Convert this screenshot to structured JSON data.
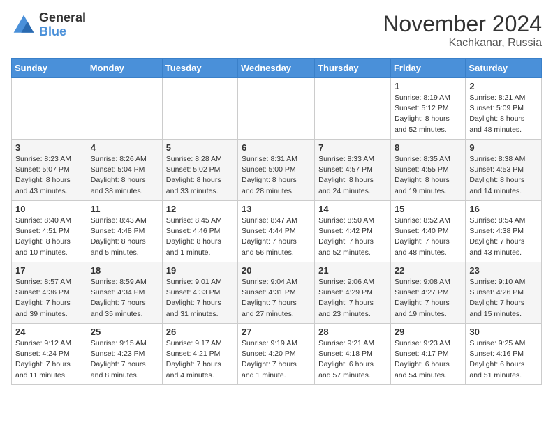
{
  "header": {
    "logo_general": "General",
    "logo_blue": "Blue",
    "month_title": "November 2024",
    "location": "Kachkanar, Russia"
  },
  "days_of_week": [
    "Sunday",
    "Monday",
    "Tuesday",
    "Wednesday",
    "Thursday",
    "Friday",
    "Saturday"
  ],
  "weeks": [
    [
      {
        "day": "",
        "info": ""
      },
      {
        "day": "",
        "info": ""
      },
      {
        "day": "",
        "info": ""
      },
      {
        "day": "",
        "info": ""
      },
      {
        "day": "",
        "info": ""
      },
      {
        "day": "1",
        "info": "Sunrise: 8:19 AM\nSunset: 5:12 PM\nDaylight: 8 hours\nand 52 minutes."
      },
      {
        "day": "2",
        "info": "Sunrise: 8:21 AM\nSunset: 5:09 PM\nDaylight: 8 hours\nand 48 minutes."
      }
    ],
    [
      {
        "day": "3",
        "info": "Sunrise: 8:23 AM\nSunset: 5:07 PM\nDaylight: 8 hours\nand 43 minutes."
      },
      {
        "day": "4",
        "info": "Sunrise: 8:26 AM\nSunset: 5:04 PM\nDaylight: 8 hours\nand 38 minutes."
      },
      {
        "day": "5",
        "info": "Sunrise: 8:28 AM\nSunset: 5:02 PM\nDaylight: 8 hours\nand 33 minutes."
      },
      {
        "day": "6",
        "info": "Sunrise: 8:31 AM\nSunset: 5:00 PM\nDaylight: 8 hours\nand 28 minutes."
      },
      {
        "day": "7",
        "info": "Sunrise: 8:33 AM\nSunset: 4:57 PM\nDaylight: 8 hours\nand 24 minutes."
      },
      {
        "day": "8",
        "info": "Sunrise: 8:35 AM\nSunset: 4:55 PM\nDaylight: 8 hours\nand 19 minutes."
      },
      {
        "day": "9",
        "info": "Sunrise: 8:38 AM\nSunset: 4:53 PM\nDaylight: 8 hours\nand 14 minutes."
      }
    ],
    [
      {
        "day": "10",
        "info": "Sunrise: 8:40 AM\nSunset: 4:51 PM\nDaylight: 8 hours\nand 10 minutes."
      },
      {
        "day": "11",
        "info": "Sunrise: 8:43 AM\nSunset: 4:48 PM\nDaylight: 8 hours\nand 5 minutes."
      },
      {
        "day": "12",
        "info": "Sunrise: 8:45 AM\nSunset: 4:46 PM\nDaylight: 8 hours\nand 1 minute."
      },
      {
        "day": "13",
        "info": "Sunrise: 8:47 AM\nSunset: 4:44 PM\nDaylight: 7 hours\nand 56 minutes."
      },
      {
        "day": "14",
        "info": "Sunrise: 8:50 AM\nSunset: 4:42 PM\nDaylight: 7 hours\nand 52 minutes."
      },
      {
        "day": "15",
        "info": "Sunrise: 8:52 AM\nSunset: 4:40 PM\nDaylight: 7 hours\nand 48 minutes."
      },
      {
        "day": "16",
        "info": "Sunrise: 8:54 AM\nSunset: 4:38 PM\nDaylight: 7 hours\nand 43 minutes."
      }
    ],
    [
      {
        "day": "17",
        "info": "Sunrise: 8:57 AM\nSunset: 4:36 PM\nDaylight: 7 hours\nand 39 minutes."
      },
      {
        "day": "18",
        "info": "Sunrise: 8:59 AM\nSunset: 4:34 PM\nDaylight: 7 hours\nand 35 minutes."
      },
      {
        "day": "19",
        "info": "Sunrise: 9:01 AM\nSunset: 4:33 PM\nDaylight: 7 hours\nand 31 minutes."
      },
      {
        "day": "20",
        "info": "Sunrise: 9:04 AM\nSunset: 4:31 PM\nDaylight: 7 hours\nand 27 minutes."
      },
      {
        "day": "21",
        "info": "Sunrise: 9:06 AM\nSunset: 4:29 PM\nDaylight: 7 hours\nand 23 minutes."
      },
      {
        "day": "22",
        "info": "Sunrise: 9:08 AM\nSunset: 4:27 PM\nDaylight: 7 hours\nand 19 minutes."
      },
      {
        "day": "23",
        "info": "Sunrise: 9:10 AM\nSunset: 4:26 PM\nDaylight: 7 hours\nand 15 minutes."
      }
    ],
    [
      {
        "day": "24",
        "info": "Sunrise: 9:12 AM\nSunset: 4:24 PM\nDaylight: 7 hours\nand 11 minutes."
      },
      {
        "day": "25",
        "info": "Sunrise: 9:15 AM\nSunset: 4:23 PM\nDaylight: 7 hours\nand 8 minutes."
      },
      {
        "day": "26",
        "info": "Sunrise: 9:17 AM\nSunset: 4:21 PM\nDaylight: 7 hours\nand 4 minutes."
      },
      {
        "day": "27",
        "info": "Sunrise: 9:19 AM\nSunset: 4:20 PM\nDaylight: 7 hours\nand 1 minute."
      },
      {
        "day": "28",
        "info": "Sunrise: 9:21 AM\nSunset: 4:18 PM\nDaylight: 6 hours\nand 57 minutes."
      },
      {
        "day": "29",
        "info": "Sunrise: 9:23 AM\nSunset: 4:17 PM\nDaylight: 6 hours\nand 54 minutes."
      },
      {
        "day": "30",
        "info": "Sunrise: 9:25 AM\nSunset: 4:16 PM\nDaylight: 6 hours\nand 51 minutes."
      }
    ]
  ]
}
